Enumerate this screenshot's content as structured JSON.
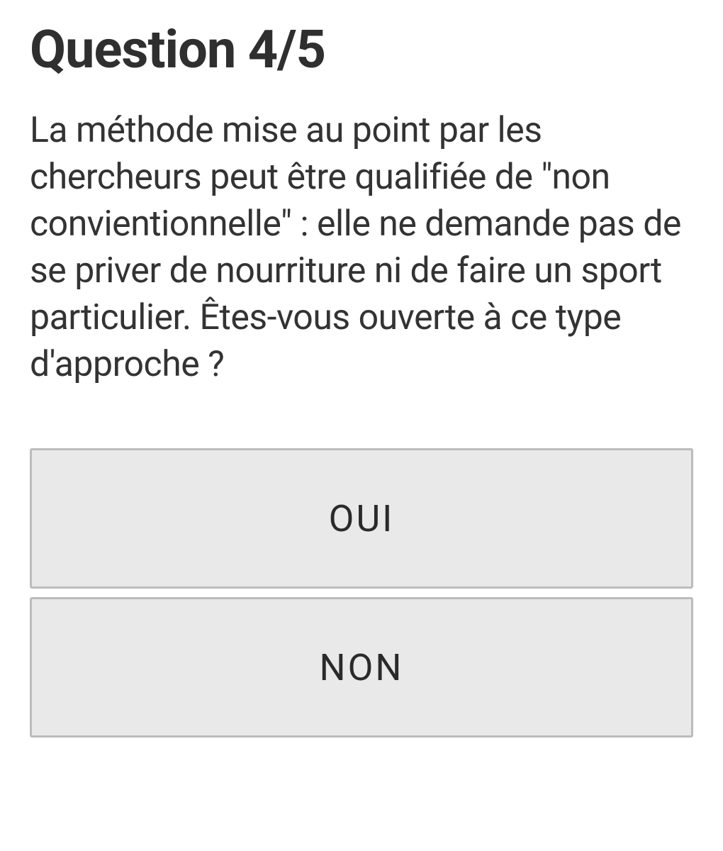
{
  "question": {
    "title": "Question 4/5",
    "text": "La méthode mise au point par les chercheurs peut être qualifiée de \"non convientionnelle\" : elle ne demande pas de se priver de nourriture ni de faire un sport particulier. Êtes-vous ouverte à ce type d'approche ?"
  },
  "answers": {
    "yes": "OUI",
    "no": "NON"
  }
}
